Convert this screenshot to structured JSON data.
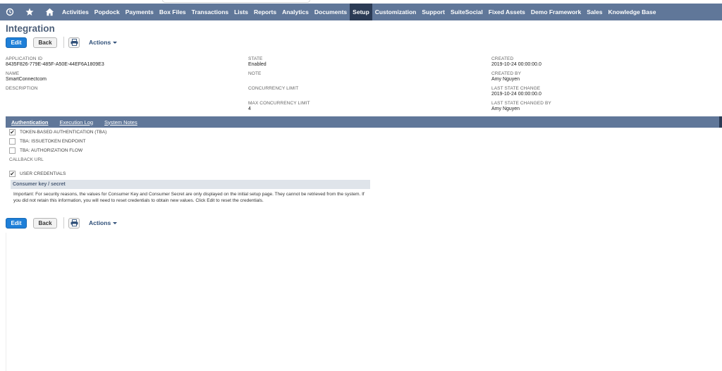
{
  "nav": {
    "items": [
      "Activities",
      "Popdock",
      "Payments",
      "Box Files",
      "Transactions",
      "Lists",
      "Reports",
      "Analytics",
      "Documents",
      "Setup",
      "Customization",
      "Support",
      "SuiteSocial",
      "Fixed Assets",
      "Demo Framework",
      "Sales",
      "Knowledge Base"
    ],
    "active": "Setup",
    "icons": [
      "recent-icon",
      "star-icon",
      "home-icon"
    ]
  },
  "page": {
    "title": "Integration"
  },
  "buttons": {
    "edit": "Edit",
    "back": "Back",
    "actions": "Actions"
  },
  "fields": {
    "application_id": {
      "label": "APPLICATION ID",
      "value": "8435F826-779E-485F-A50E-44EF6A1809E3"
    },
    "name": {
      "label": "NAME",
      "value": "SmartConnectcom"
    },
    "description": {
      "label": "DESCRIPTION",
      "value": ""
    },
    "state": {
      "label": "STATE",
      "value": "Enabled"
    },
    "note": {
      "label": "NOTE",
      "value": ""
    },
    "concurrency_limit": {
      "label": "CONCURRENCY LIMIT",
      "value": ""
    },
    "max_concurrency_limit": {
      "label": "MAX CONCURRENCY LIMIT",
      "value": "4"
    },
    "created": {
      "label": "CREATED",
      "value": "2019-10-24 00:00:00.0"
    },
    "created_by": {
      "label": "CREATED BY",
      "value": "Amy Nguyen"
    },
    "last_state_change": {
      "label": "LAST STATE CHANGE",
      "value": "2019-10-24 00:00:00.0"
    },
    "last_state_changed_by": {
      "label": "LAST STATE CHANGED BY",
      "value": "Amy Nguyen"
    }
  },
  "tabs": [
    "Authentication",
    "Execution Log",
    "System Notes"
  ],
  "active_tab": "Authentication",
  "auth": {
    "tba": {
      "label": "TOKEN-BASED AUTHENTICATION (TBA)",
      "checked": true
    },
    "tba_issuetoken": {
      "label": "TBA: ISSUETOKEN ENDPOINT",
      "checked": false
    },
    "tba_authflow": {
      "label": "TBA: AUTHORIZATION FLOW",
      "checked": false
    },
    "callback_url": {
      "label": "CALLBACK URL"
    },
    "user_credentials": {
      "label": "USER CREDENTIALS",
      "checked": true
    }
  },
  "consumer": {
    "heading": "Consumer key / secret",
    "notice": "Important: For security reasons, the values for Consumer Key and Consumer Secret are only displayed on the initial setup page. They cannot be retrieved from the system. If you did not retain this information, you will need to reset credentials to obtain new values. Click Edit to reset the credentials."
  },
  "colors": {
    "navbar": "#607799",
    "nav_active": "#2b3b55",
    "edit_button": "#1e7fd8",
    "title": "#4d5f79"
  }
}
